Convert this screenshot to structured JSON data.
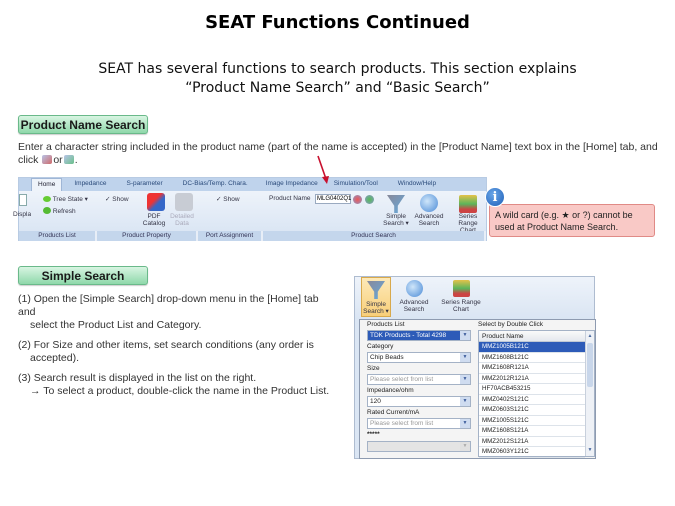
{
  "title": "SEAT Functions Continued",
  "subtitle": {
    "line1": "SEAT has several functions to search products. This section explains",
    "line2": "“Product Name Search” and “Basic Search”"
  },
  "product_name_search": {
    "heading": "Product Name Search",
    "description_part1": "Enter a character string included in the product name (part of the name is accepted) in the [Product Name] text box in the [Home] tab, and click",
    "description_or": "or",
    "description_end": ".",
    "ribbon": {
      "tabs": [
        "Home",
        "Impedance",
        "S-parameter",
        "DC-Bias/Temp. Chara.",
        "Image Impedance",
        "Simulation/Tool",
        "Window/Help"
      ],
      "display_format_label": "Display Format ▾",
      "tree_state_label": "Tree State ▾",
      "refresh_label": "Refresh",
      "show_label_1": "Show",
      "pdf_catalog_label": "PDF Catalog",
      "detailed_data_label": "Detailed Data",
      "show_label_2": "Show",
      "product_name_label": "Product Name",
      "product_name_value": "MLG0402Q1",
      "simple_search_label": "Simple Search ▾",
      "advanced_search_label": "Advanced Search",
      "series_range_chart_label": "Series Range Chart",
      "groups": [
        "Products List",
        "Product Property",
        "Port Assignment",
        "Product Search"
      ]
    },
    "callout": {
      "icon": "info-icon",
      "text": "A wild card (e.g. ★ or ?) cannot be used at Product Name Search."
    }
  },
  "simple_search": {
    "heading": "Simple Search",
    "steps": [
      {
        "line1": "(1) Open the [Simple Search] drop-down menu in the [Home] tab and",
        "line2": "select the Product List and Category."
      },
      {
        "line1": "(2) For Size and other items, set search conditions (any order is",
        "line2": "accepted)."
      },
      {
        "line1": "(3) Search result is displayed in the list on the right.",
        "line2": "→ To select a product, double-click the name in the Product List."
      }
    ],
    "panel": {
      "simple_search_label": "Simple Search ▾",
      "advanced_search_label": "Advanced Search",
      "series_range_chart_label": "Series Range Chart",
      "fields": [
        {
          "label": "Products List",
          "value": "TDK Products - Total 4298"
        },
        {
          "label": "Category",
          "value": "Chip Beads"
        },
        {
          "label": "Size",
          "value": "Please select from list"
        },
        {
          "label": "Impedance/ohm",
          "value": "120"
        },
        {
          "label": "Rated Current/mA",
          "value": "Please select from list"
        },
        {
          "label": "*****",
          "value": ""
        }
      ],
      "list_caption": "Select by Double Click",
      "list_header": "Product Name",
      "products": [
        "MMZ1005B121C",
        "MMZ1608B121C",
        "MMZ1608R121A",
        "MMZ2012R121A",
        "HF70ACB453215",
        "MMZ0402S121C",
        "MMZ0603S121C",
        "MMZ1005S121C",
        "MMZ1608S121A",
        "MMZ2012S121A",
        "MMZ0603Y121C"
      ]
    }
  },
  "colors": {
    "badge_green": "#8fd8aa",
    "callout_pink": "#f9c9c6",
    "selection_blue": "#2d5bb8",
    "ribbon_blue": "#dbe6f4",
    "arrow_red": "#c8102e"
  }
}
